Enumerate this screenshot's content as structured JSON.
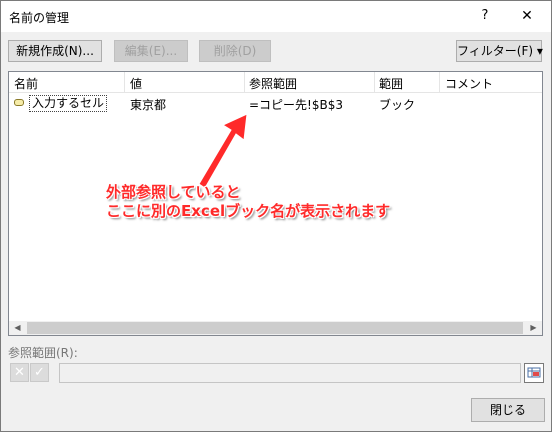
{
  "window": {
    "title": "名前の管理",
    "help": "?",
    "close": "✕"
  },
  "toolbar": {
    "new_label": "新規作成(N)...",
    "edit_label": "編集(E)...",
    "delete_label": "削除(D)",
    "filter_label": "フィルター(F) ▾"
  },
  "columns": [
    "名前",
    "値",
    "参照範囲",
    "範囲",
    "コメント"
  ],
  "rows": [
    {
      "name": "入力するセル",
      "value": "東京都",
      "refers_to": "=コピー先!$B$3",
      "scope": "ブック",
      "comment": ""
    }
  ],
  "ref_label": "参照範囲(R):",
  "ref_input_value": "",
  "close_button": "閉じる",
  "annotation": {
    "line1": "外部参照していると",
    "line2": "ここに別のExcelブック名が表示されます"
  },
  "colors": {
    "annotation": "#ff2a2a"
  }
}
